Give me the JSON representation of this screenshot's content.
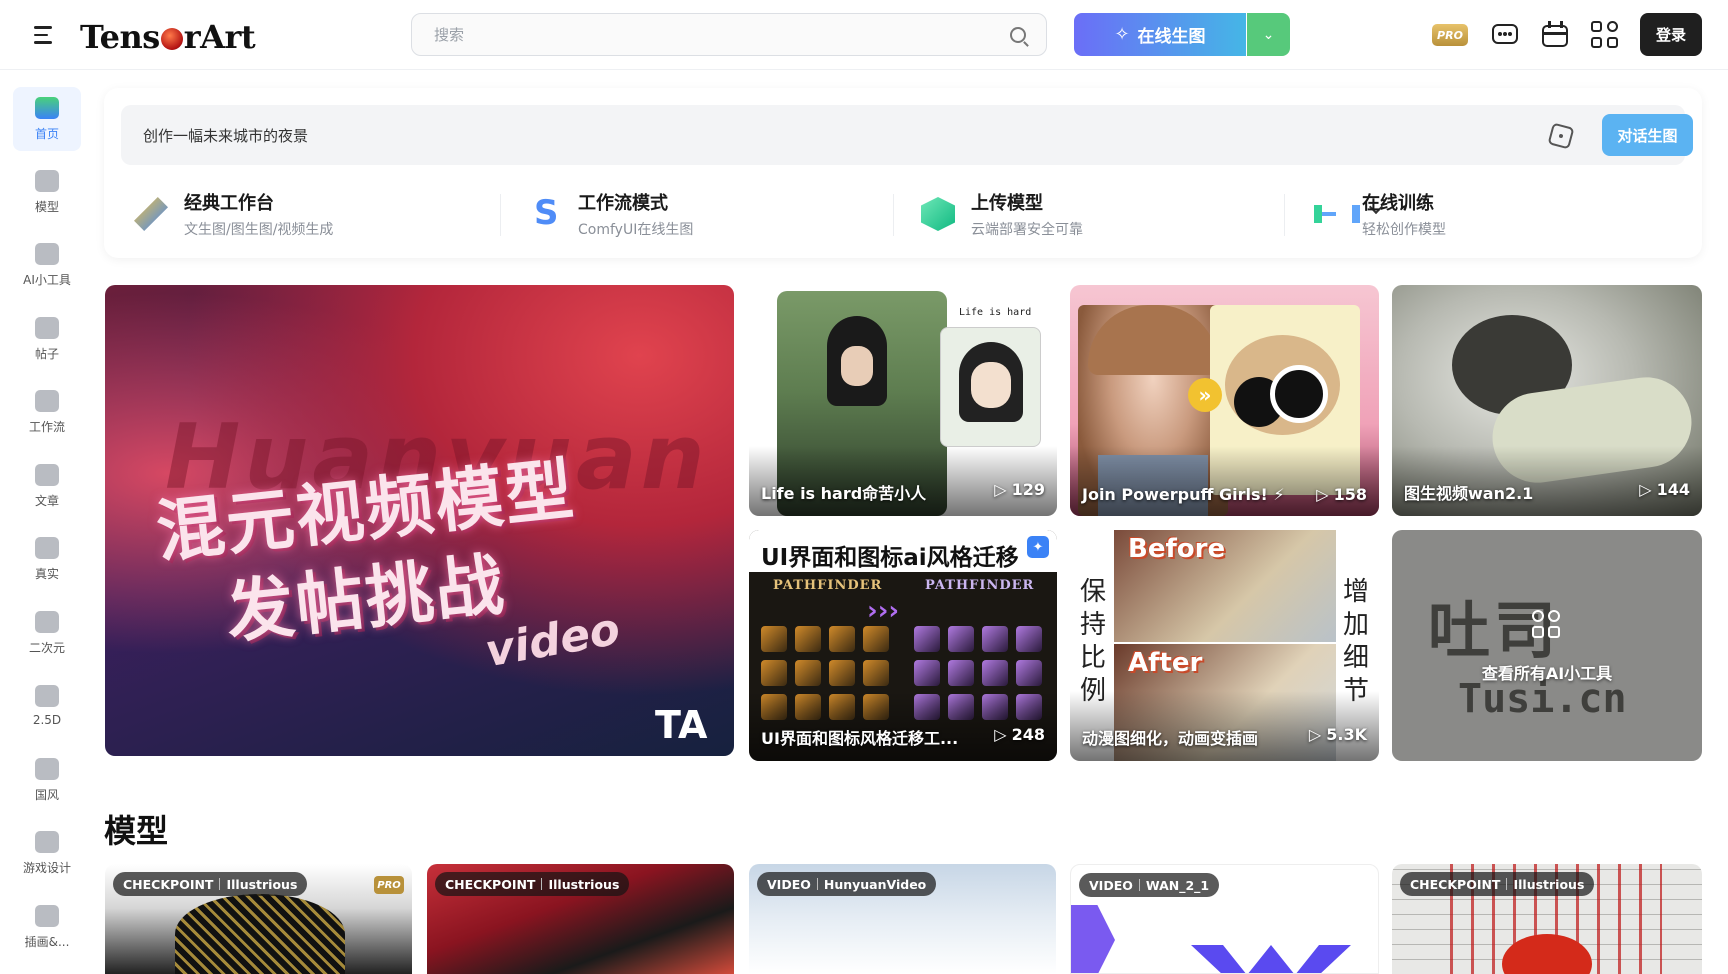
{
  "header": {
    "logo_text_1": "Tens",
    "logo_text_2": "rArt",
    "search_placeholder": "搜索",
    "generate_label": "在线生图",
    "pro_label": "PRO",
    "login_label": "登录"
  },
  "sidebar": {
    "items": [
      {
        "label": "首页",
        "icon": "home-icon",
        "active": true
      },
      {
        "label": "模型",
        "icon": "cube-icon"
      },
      {
        "label": "AI小工具",
        "icon": "tools-icon"
      },
      {
        "label": "帖子",
        "icon": "posts-icon"
      },
      {
        "label": "工作流",
        "icon": "workflow-icon"
      },
      {
        "label": "文章",
        "icon": "article-icon"
      },
      {
        "label": "真实",
        "icon": "camera-icon"
      },
      {
        "label": "二次元",
        "icon": "anime-icon"
      },
      {
        "label": "2.5D",
        "icon": "ufo-icon"
      },
      {
        "label": "国风",
        "icon": "palette-icon"
      },
      {
        "label": "游戏设计",
        "icon": "gamepad-icon"
      },
      {
        "label": "插画&...",
        "icon": "illustration-icon"
      }
    ]
  },
  "prompt": {
    "text": "创作一幅未来城市的夜景",
    "button": "对话生图"
  },
  "quick_actions": [
    {
      "title": "经典工作台",
      "subtitle": "文生图/图生图/视频生成"
    },
    {
      "title": "工作流模式",
      "subtitle": "ComfyUI在线生图"
    },
    {
      "title": "上传模型",
      "subtitle": "云端部署安全可靠"
    },
    {
      "title": "在线训练",
      "subtitle": "轻松创作模型"
    }
  ],
  "banner": {
    "bg_text": "Huanyuan",
    "line1": "混元视频模型",
    "line2": "发帖挑战",
    "video": "video",
    "ta": "TA"
  },
  "tiles": [
    {
      "title": "Life is hard命苦小人",
      "views": "129",
      "caption": "Life is hard"
    },
    {
      "title": "Join Powerpuff Girls! ⚡",
      "views": "158"
    },
    {
      "title": "图生视频wan2.1",
      "views": "144"
    },
    {
      "title": "UI界面和图标风格迁移工...",
      "views": "248",
      "header": "UI界面和图标ai风格迁移",
      "pf": "PATHFINDER"
    },
    {
      "title": "动漫图细化，动画变插画",
      "views": "5.3K",
      "before": "Before",
      "after": "After",
      "left_text": "保持比例",
      "right_text": "增加细节"
    },
    {
      "title": "查看所有AI小工具",
      "bg_text": "吐司",
      "bg_text2": "Tusi.cn"
    }
  ],
  "models_section": {
    "title": "模型",
    "cards": [
      {
        "type": "CHECKPOINT",
        "base": "Illustrious",
        "pro": "PRO"
      },
      {
        "type": "CHECKPOINT",
        "base": "Illustrious"
      },
      {
        "type": "VIDEO",
        "base": "HunyuanVideo"
      },
      {
        "type": "VIDEO",
        "base": "WAN_2_1"
      },
      {
        "type": "CHECKPOINT",
        "base": "Illustrious"
      }
    ]
  }
}
